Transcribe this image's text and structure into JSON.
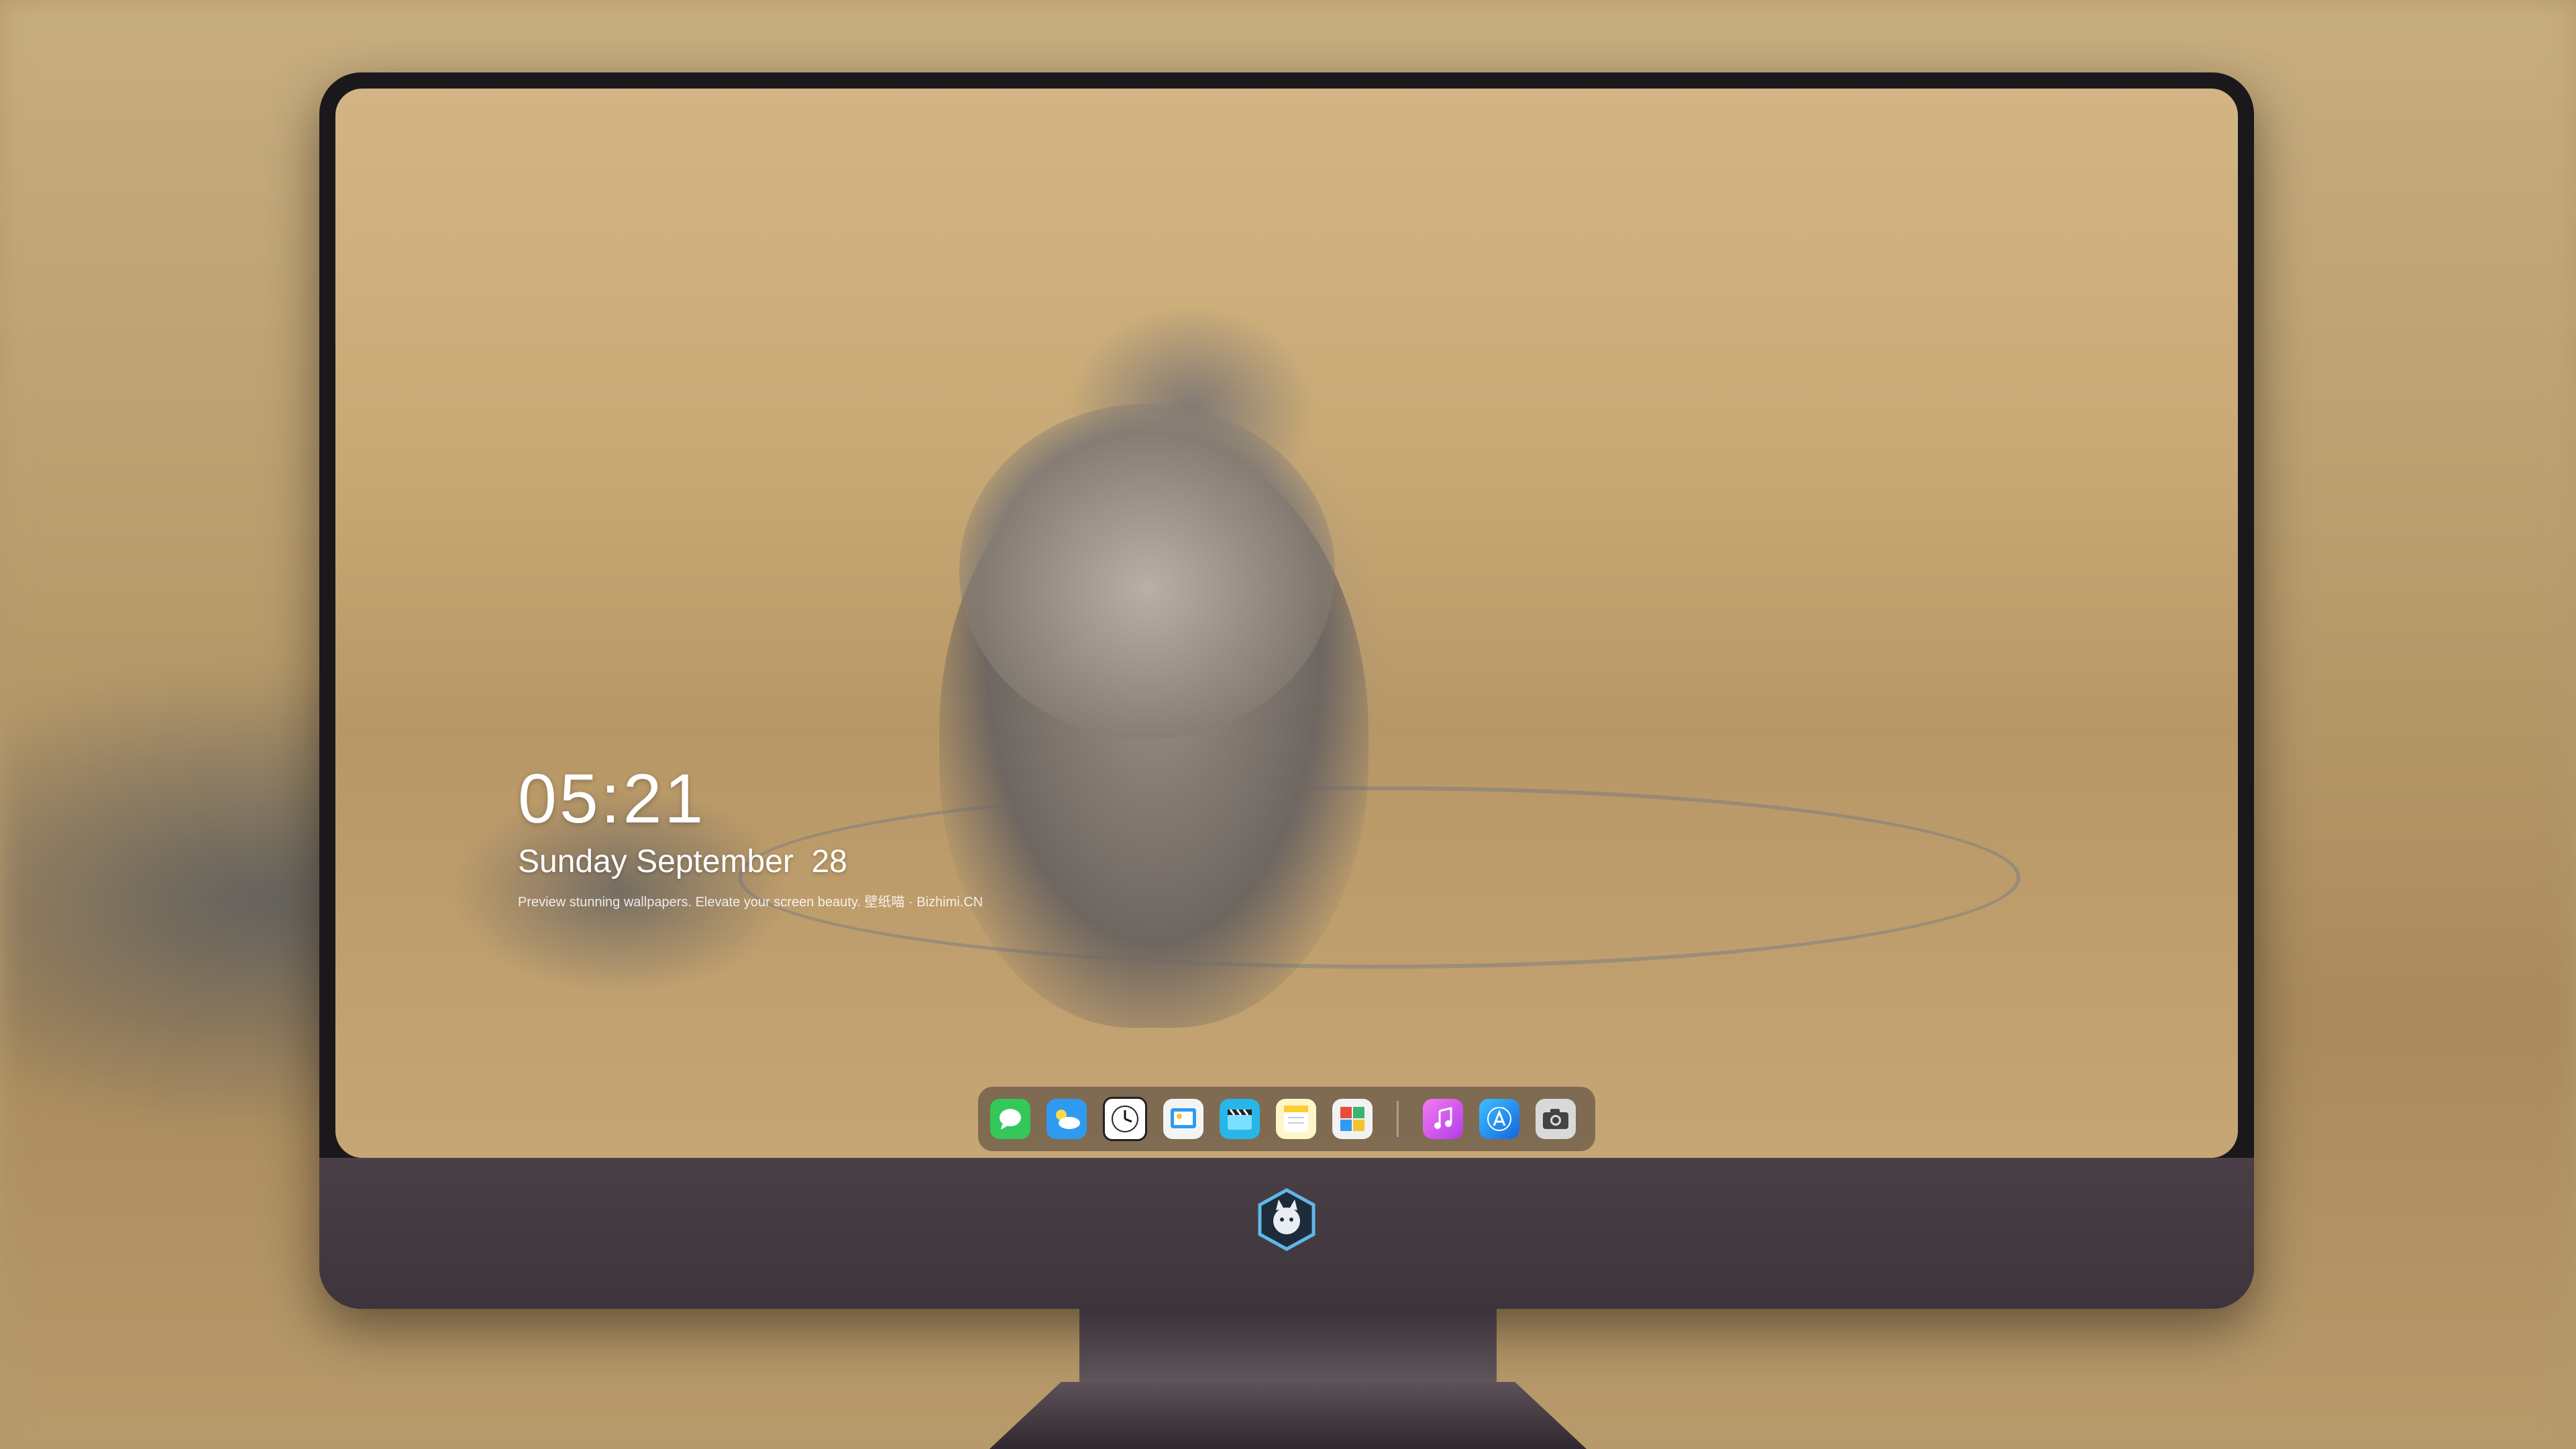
{
  "lock_screen": {
    "time": "05:21",
    "date": "Sunday September  28",
    "caption": "Preview stunning wallpapers. Elevate your screen beauty. 壁纸喵 · Bizhimi.CN"
  },
  "dock": {
    "apps": [
      {
        "name": "Messages",
        "icon": "message-icon",
        "color": "#34c759",
        "glyph": "💬"
      },
      {
        "name": "Weather",
        "icon": "weather-icon",
        "color": "#2f9bf0",
        "glyph": "⛅"
      },
      {
        "name": "Clock",
        "icon": "clock-icon",
        "color": "#ffffff",
        "glyph": "🕐"
      },
      {
        "name": "Preview",
        "icon": "preview-icon",
        "color": "#f4c430",
        "glyph": "🖼"
      },
      {
        "name": "Clips",
        "icon": "clapper-icon",
        "color": "#28b6e8",
        "glyph": "🎬"
      },
      {
        "name": "Notes",
        "icon": "notes-icon",
        "color": "#ffe27a",
        "glyph": "📝"
      },
      {
        "name": "Photo Booth",
        "icon": "photos-icon",
        "color": "#e94b3c",
        "glyph": "🗂"
      },
      {
        "name": "Music",
        "icon": "music-icon",
        "color": "#e64fd8",
        "glyph": "♫"
      },
      {
        "name": "App Store",
        "icon": "app-store-icon",
        "color": "#1c8cf0",
        "glyph": "A"
      },
      {
        "name": "Camera",
        "icon": "camera-icon",
        "color": "#555555",
        "glyph": "📷"
      }
    ]
  }
}
